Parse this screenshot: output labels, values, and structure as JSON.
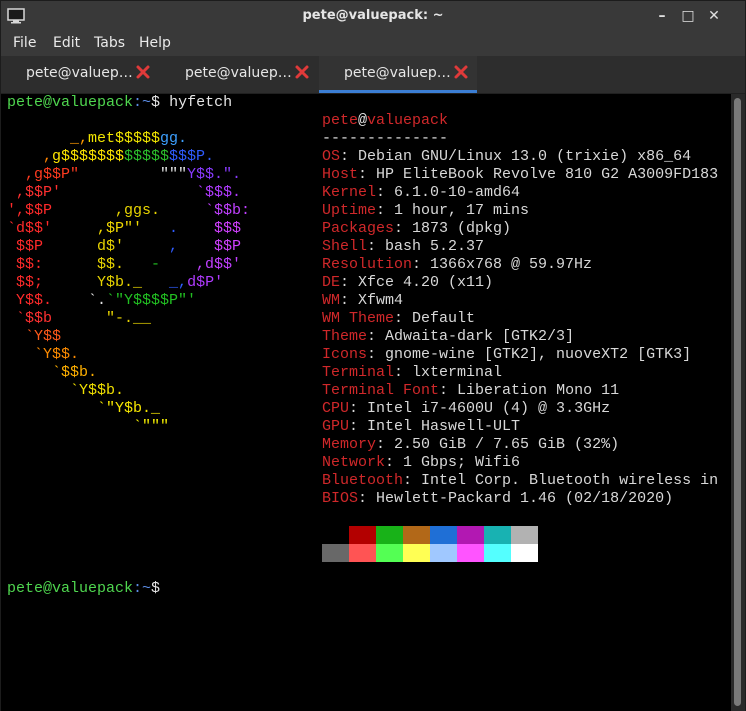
{
  "window": {
    "title": "pete@valuepack: ~",
    "minimize_glyph": "–",
    "maximize_glyph": "□",
    "close_glyph": "✕"
  },
  "menu": [
    "File",
    "Edit",
    "Tabs",
    "Help"
  ],
  "tabs": [
    {
      "label": "pete@valuep…",
      "active": false
    },
    {
      "label": "pete@valuep…",
      "active": false
    },
    {
      "label": "pete@valuep…",
      "active": true
    }
  ],
  "colors": {
    "prompt_green": "#4fd64f",
    "label_red": "#d0282a",
    "accent_blue": "#3b7ed4"
  },
  "terminal": {
    "prompt_user": "pete@valuepack",
    "prompt_path": ":~",
    "prompt_symbol": "$",
    "command": "hyfetch",
    "header_user": "pete",
    "header_at": "@",
    "header_host": "valuepack",
    "separator": "--------------",
    "info": [
      {
        "label": "OS",
        "value": "Debian GNU/Linux 13.0 (trixie) x86_64"
      },
      {
        "label": "Host",
        "value": "HP EliteBook Revolve 810 G2 A3009FD183"
      },
      {
        "label": "Kernel",
        "value": "6.1.0-10-amd64"
      },
      {
        "label": "Uptime",
        "value": "1 hour, 17 mins"
      },
      {
        "label": "Packages",
        "value": "1873 (dpkg)"
      },
      {
        "label": "Shell",
        "value": "bash 5.2.37"
      },
      {
        "label": "Resolution",
        "value": "1366x768 @ 59.97Hz"
      },
      {
        "label": "DE",
        "value": "Xfce 4.20 (x11)"
      },
      {
        "label": "WM",
        "value": "Xfwm4"
      },
      {
        "label": "WM Theme",
        "value": "Default"
      },
      {
        "label": "Theme",
        "value": "Adwaita-dark [GTK2/3]"
      },
      {
        "label": "Icons",
        "value": "gnome-wine [GTK2], nuoveXT2 [GTK3]"
      },
      {
        "label": "Terminal",
        "value": "lxterminal"
      },
      {
        "label": "Terminal Font",
        "value": "Liberation Mono 11"
      },
      {
        "label": "CPU",
        "value": "Intel i7-4600U (4) @ 3.3GHz"
      },
      {
        "label": "GPU",
        "value": "Intel Haswell-ULT"
      },
      {
        "label": "Memory",
        "value": "2.50 GiB / 7.65 GiB (32%)"
      },
      {
        "label": "Network",
        "value": "1 Gbps; Wifi6"
      },
      {
        "label": "Bluetooth",
        "value": "Intel Corp. Bluetooth wireless in"
      },
      {
        "label": "BIOS",
        "value": "Hewlett-Packard 1.46 (02/18/2020)"
      }
    ],
    "palette_dark": [
      "#000000",
      "#b30000",
      "#18b218",
      "#b26818",
      "#1f6fd6",
      "#b218b2",
      "#18b2b2",
      "#b2b2b2"
    ],
    "palette_bright": [
      "#686868",
      "#ff5454",
      "#54ff54",
      "#ffff54",
      "#a0c8ff",
      "#ff54ff",
      "#54ffff",
      "#ffffff"
    ],
    "logo": [
      [
        {
          "t": "       _,",
          "c": "#ff9a00"
        },
        {
          "t": "met$$$$$",
          "c": "#f2e600"
        },
        {
          "t": "gg.",
          "c": "#3da0ff"
        }
      ],
      [
        {
          "t": "    ,",
          "c": "#ff8400"
        },
        {
          "t": "g$$$$$$$",
          "c": "#ffe600"
        },
        {
          "t": "$$$$$",
          "c": "#2cc02c"
        },
        {
          "t": "$$$P.",
          "c": "#2f5cff"
        }
      ],
      [
        {
          "t": "  ,g$$P\"",
          "c": "#ff3b1f"
        },
        {
          "t": "         \"\"\"",
          "c": "#e4e4e4"
        },
        {
          "t": "Y$$.\".",
          "c": "#8a3bff"
        }
      ],
      [
        {
          "t": " ,$$P'",
          "c": "#ff3030"
        },
        {
          "t": "               `$$$.",
          "c": "#b03bff"
        }
      ],
      [
        {
          "t": "',$$P",
          "c": "#ff2a2a"
        },
        {
          "t": "       ,ggs.",
          "c": "#e8d400"
        },
        {
          "t": "     `$$b:",
          "c": "#c040ff"
        }
      ],
      [
        {
          "t": "`d$$'",
          "c": "#ff2a2a"
        },
        {
          "t": "     ,$P\"'",
          "c": "#f0d800"
        },
        {
          "t": "   .",
          "c": "#2f5cff"
        },
        {
          "t": "    $$$",
          "c": "#d040ff"
        }
      ],
      [
        {
          "t": " $$P",
          "c": "#ff2a2a"
        },
        {
          "t": "      d$'",
          "c": "#e8d400"
        },
        {
          "t": "     ,",
          "c": "#2f5cff"
        },
        {
          "t": "    $$P",
          "c": "#d040ff"
        }
      ],
      [
        {
          "t": " $$:",
          "c": "#ff2a2a"
        },
        {
          "t": "      $$.",
          "c": "#e8d400"
        },
        {
          "t": "   -",
          "c": "#22c022"
        },
        {
          "t": "    ,d$$'",
          "c": "#c040ff"
        }
      ],
      [
        {
          "t": " $$;",
          "c": "#ff2a2a"
        },
        {
          "t": "      Y$b._",
          "c": "#e8d400"
        },
        {
          "t": "   _,",
          "c": "#2f5cff"
        },
        {
          "t": "d$P'",
          "c": "#b03bff"
        }
      ],
      [
        {
          "t": " Y$$.",
          "c": "#ff2a2a"
        },
        {
          "t": "    `.",
          "c": "#e4e4e4"
        },
        {
          "t": "`\"Y$$$$P\"'",
          "c": "#22c022"
        }
      ],
      [
        {
          "t": " `$$b",
          "c": "#ff3030"
        },
        {
          "t": "      \"-.__",
          "c": "#e8d400"
        }
      ],
      [
        {
          "t": "  `Y$$",
          "c": "#ff5a1a"
        }
      ],
      [
        {
          "t": "   `Y$$.",
          "c": "#ff8c00"
        }
      ],
      [
        {
          "t": "     `$$b.",
          "c": "#ffb000"
        }
      ],
      [
        {
          "t": "       `Y$$b.",
          "c": "#f0e000"
        }
      ],
      [
        {
          "t": "          `\"Y$b._",
          "c": "#f6e600"
        }
      ],
      [
        {
          "t": "              `\"\"\"",
          "c": "#f6f000"
        }
      ]
    ]
  }
}
